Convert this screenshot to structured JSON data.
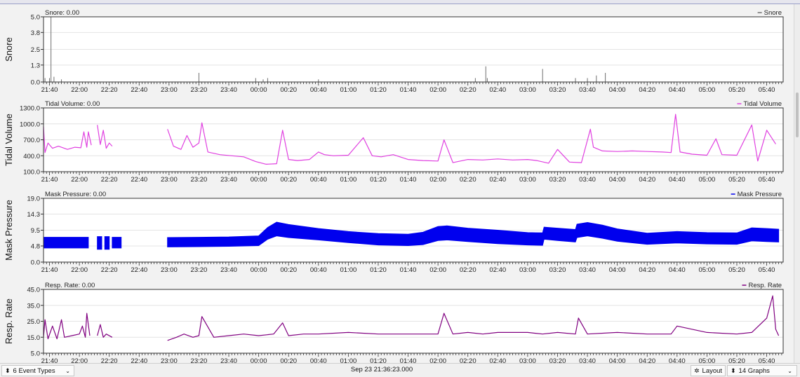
{
  "chart_data": [
    {
      "type": "line",
      "ylabel": "Snore",
      "title": "Snore: 0.00",
      "legend": "Snore",
      "legend_position": "top-right",
      "color": "#6e6e6e",
      "ylim": [
        0,
        5
      ],
      "yticks": [
        "0.0",
        "1.3",
        "2.5",
        "3.8",
        "5.0"
      ],
      "grid": true,
      "series": [
        {
          "name": "Snore",
          "style": "spikes",
          "x": [
            "21:37",
            "21:40",
            "21:41",
            "21:43",
            "21:48",
            "23:20",
            "23:58",
            "00:03",
            "00:06",
            "00:40",
            "02:25",
            "02:32",
            "02:33",
            "03:10",
            "03:32",
            "03:40",
            "03:46",
            "03:52"
          ],
          "y": [
            0.3,
            0.3,
            5.0,
            0.4,
            0.2,
            0.7,
            0.3,
            0.2,
            0.3,
            0.2,
            0.3,
            1.2,
            0.3,
            1.0,
            0.3,
            0.3,
            0.5,
            0.7
          ]
        }
      ]
    },
    {
      "type": "line",
      "ylabel": "Tidal Volume",
      "title": "Tidal Volume: 0.00",
      "legend": "Tidal Volume",
      "legend_position": "top-right",
      "color": "#e040e0",
      "ylim": [
        100,
        1300
      ],
      "yticks": [
        "100.0",
        "400.0",
        "700.0",
        "1000.0",
        "1300.0"
      ],
      "grid": true,
      "series": [
        {
          "name": "Tidal Volume",
          "segments": [
            {
              "x": [
                "21:36",
                "21:37",
                "21:39",
                "21:42",
                "21:46",
                "21:52",
                "21:57",
                "22:01",
                "22:03",
                "22:05",
                "22:06",
                "22:08"
              ],
              "y": [
                950,
                460,
                640,
                540,
                580,
                520,
                560,
                550,
                850,
                560,
                850,
                600
              ]
            },
            {
              "x": [
                "22:12",
                "22:14",
                "22:16",
                "22:18",
                "22:20",
                "22:22"
              ],
              "y": [
                980,
                610,
                880,
                540,
                640,
                580
              ]
            },
            {
              "x": [
                "22:59",
                "23:03",
                "23:08",
                "23:12",
                "23:16",
                "23:20",
                "23:22",
                "23:26",
                "23:34",
                "23:42",
                "23:50",
                "23:58",
                "00:05",
                "00:12",
                "00:16",
                "00:20",
                "00:26",
                "00:34",
                "00:40",
                "00:44",
                "00:50",
                "01:00",
                "01:10",
                "01:16",
                "01:22",
                "01:30",
                "01:40",
                "01:50",
                "02:00",
                "02:04",
                "02:10",
                "02:20",
                "02:30",
                "02:40",
                "02:50",
                "03:00",
                "03:06",
                "03:14",
                "03:20",
                "03:28",
                "03:36",
                "03:42",
                "03:44",
                "03:50",
                "04:00",
                "04:10",
                "04:20",
                "04:30",
                "04:36",
                "04:39",
                "04:42",
                "04:50",
                "05:00",
                "05:06",
                "05:10",
                "05:20",
                "05:30",
                "05:34",
                "05:40",
                "05:46"
              ],
              "y": [
                900,
                580,
                520,
                780,
                560,
                640,
                1020,
                470,
                420,
                400,
                380,
                290,
                240,
                250,
                880,
                330,
                310,
                330,
                470,
                420,
                400,
                410,
                740,
                400,
                380,
                420,
                330,
                310,
                300,
                700,
                270,
                330,
                320,
                340,
                320,
                330,
                310,
                260,
                520,
                280,
                270,
                900,
                560,
                490,
                480,
                490,
                480,
                470,
                460,
                1180,
                470,
                430,
                410,
                720,
                420,
                410,
                980,
                300,
                880,
                620
              ]
            }
          ]
        }
      ]
    },
    {
      "type": "area",
      "ylabel": "Mask Pressure",
      "title": "Mask Pressure: 0.00",
      "legend": "Mask Pressure",
      "legend_position": "top-right",
      "color": "#0000ee",
      "ylim": [
        0,
        19
      ],
      "yticks": [
        "0.0",
        "4.8",
        "9.5",
        "14.3",
        "19.0"
      ],
      "grid": true,
      "series": [
        {
          "name": "Mask Pressure",
          "segments": [
            {
              "x": [
                "21:36",
                "21:40",
                "21:50",
                "22:00",
                "22:06"
              ],
              "lo": [
                4.2,
                4.2,
                4.2,
                4.2,
                4.2
              ],
              "hi": [
                7.4,
                7.4,
                7.4,
                7.4,
                7.4
              ]
            },
            {
              "x": [
                "22:12",
                "22:15"
              ],
              "lo": [
                3.8,
                3.8
              ],
              "hi": [
                7.6,
                7.6
              ]
            },
            {
              "x": [
                "22:17",
                "22:20"
              ],
              "lo": [
                3.8,
                3.8
              ],
              "hi": [
                7.6,
                7.6
              ]
            },
            {
              "x": [
                "22:22",
                "22:28"
              ],
              "lo": [
                4.2,
                4.2
              ],
              "hi": [
                7.4,
                7.4
              ]
            },
            {
              "x": [
                "22:59",
                "23:20",
                "23:40",
                "00:00",
                "00:06",
                "00:12",
                "00:20",
                "00:40",
                "01:00",
                "01:20",
                "01:40",
                "01:50",
                "02:00",
                "02:06",
                "02:20",
                "02:40",
                "03:00",
                "03:10",
                "03:11",
                "03:20",
                "03:32",
                "03:33",
                "03:40",
                "03:50",
                "04:00",
                "04:20",
                "04:40",
                "05:00",
                "05:20",
                "05:30",
                "05:40",
                "05:48"
              ],
              "lo": [
                4.5,
                4.6,
                4.7,
                4.9,
                6.8,
                7.8,
                7.3,
                6.6,
                5.8,
                5.1,
                4.9,
                5.2,
                6.4,
                6.6,
                6.1,
                5.5,
                5.1,
                5.0,
                6.8,
                6.4,
                6.0,
                7.3,
                7.8,
                7.1,
                6.2,
                5.3,
                5.7,
                5.4,
                5.3,
                6.3,
                6.1,
                6.0
              ],
              "hi": [
                7.3,
                7.4,
                7.5,
                7.8,
                10.3,
                11.9,
                11.2,
                10.0,
                9.1,
                8.5,
                8.3,
                8.9,
                10.6,
                10.8,
                10.1,
                9.5,
                8.8,
                8.7,
                10.4,
                10.1,
                9.7,
                11.3,
                11.8,
                11.0,
                9.9,
                8.6,
                9.1,
                8.8,
                8.7,
                10.2,
                10.0,
                9.8
              ]
            }
          ]
        }
      ]
    },
    {
      "type": "line",
      "ylabel": "Resp. Rate",
      "title": "Resp. Rate: 0.00",
      "legend": "Resp. Rate",
      "legend_position": "top-right",
      "color": "#800080",
      "ylim": [
        5,
        45
      ],
      "yticks": [
        "5.0",
        "15.0",
        "25.0",
        "35.0",
        "45.0"
      ],
      "grid": true,
      "series": [
        {
          "name": "Resp. Rate",
          "segments": [
            {
              "x": [
                "21:36",
                "21:37",
                "21:39",
                "21:42",
                "21:45",
                "21:48",
                "21:50",
                "21:55",
                "22:00",
                "22:02",
                "22:04",
                "22:05",
                "22:07"
              ],
              "y": [
                15,
                26,
                14,
                22,
                14,
                26,
                15,
                16,
                17,
                22,
                15,
                30,
                16
              ]
            },
            {
              "x": [
                "22:12",
                "22:14",
                "22:16",
                "22:18",
                "22:22"
              ],
              "y": [
                16,
                23,
                15,
                17,
                15
              ]
            },
            {
              "x": [
                "22:59",
                "23:05",
                "23:10",
                "23:16",
                "23:20",
                "23:22",
                "23:30",
                "23:40",
                "23:50",
                "00:00",
                "00:10",
                "00:16",
                "00:20",
                "00:30",
                "00:40",
                "01:00",
                "01:20",
                "01:40",
                "02:00",
                "02:04",
                "02:10",
                "02:20",
                "02:30",
                "02:40",
                "03:00",
                "03:10",
                "03:20",
                "03:32",
                "03:34",
                "03:40",
                "04:00",
                "04:20",
                "04:36",
                "04:40",
                "05:00",
                "05:20",
                "05:30",
                "05:40",
                "05:44",
                "05:46",
                "05:48"
              ],
              "y": [
                13,
                15,
                17,
                15,
                16,
                28,
                15,
                16,
                17,
                16,
                17,
                24,
                16,
                17,
                17,
                18,
                17,
                17,
                17,
                30,
                17,
                18,
                17,
                18,
                18,
                17,
                18,
                17,
                27,
                17,
                18,
                17,
                17,
                22,
                18,
                17,
                18,
                27,
                41,
                20,
                16
              ]
            }
          ]
        }
      ]
    }
  ],
  "x_axis": {
    "ticks": [
      "21:40",
      "22:00",
      "22:20",
      "22:40",
      "23:00",
      "23:20",
      "23:40",
      "00:00",
      "00:20",
      "00:40",
      "01:00",
      "01:20",
      "01:40",
      "02:00",
      "02:20",
      "02:40",
      "03:00",
      "03:20",
      "03:40",
      "04:00",
      "04:20",
      "04:40",
      "05:00",
      "05:20",
      "05:40"
    ],
    "start": "21:36",
    "end": "05:51"
  },
  "bottom_bar": {
    "event_types": "6 Event Types",
    "event_icon": "up-down-arrows-icon",
    "datetime": "Sep 23 21:36:23.000",
    "layout_label": "Layout",
    "layout_icon": "gear-icon",
    "graphs_label": "14 Graphs",
    "graphs_icon": "up-down-arrows-icon"
  }
}
